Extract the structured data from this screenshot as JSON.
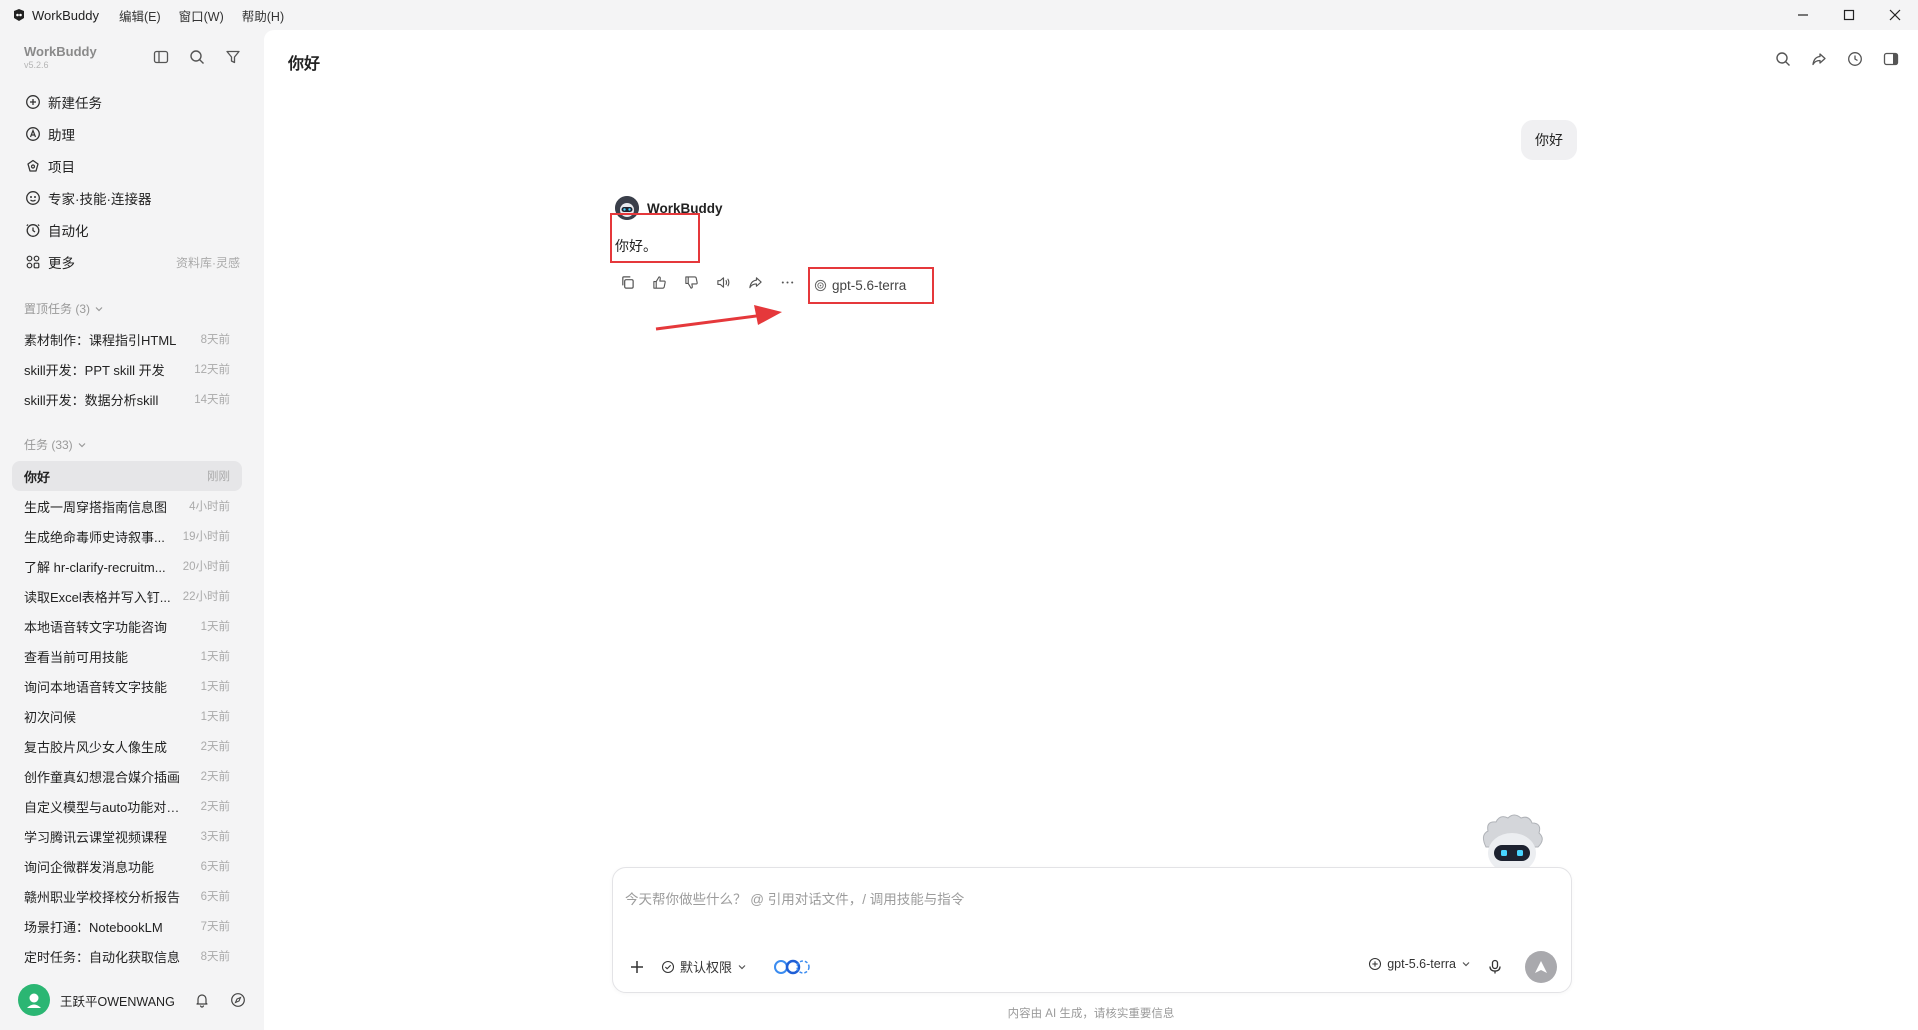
{
  "titlebar": {
    "app_name": "WorkBuddy",
    "menus": [
      "编辑(E)",
      "窗口(W)",
      "帮助(H)"
    ]
  },
  "sidebar": {
    "brand": "WorkBuddy",
    "version": "v5.2.6",
    "nav": [
      {
        "label": "新建任务",
        "icon": "plus-circle-icon"
      },
      {
        "label": "助理",
        "icon": "assistant-icon"
      },
      {
        "label": "项目",
        "icon": "project-icon"
      },
      {
        "label": "专家·技能·连接器",
        "icon": "expert-icon"
      },
      {
        "label": "自动化",
        "icon": "clock-icon"
      },
      {
        "label": "更多",
        "icon": "grid-icon",
        "sub": "资料库·灵感"
      }
    ],
    "pinned_title": "置顶任务 (3)",
    "pinned": [
      {
        "title": "素材制作：课程指引HTML",
        "time": "8天前"
      },
      {
        "title": "skill开发：PPT skill 开发",
        "time": "12天前"
      },
      {
        "title": "skill开发：数据分析skill",
        "time": "14天前"
      }
    ],
    "tasks_title": "任务 (33)",
    "tasks": [
      {
        "title": "你好",
        "time": "刚刚"
      },
      {
        "title": "生成一周穿搭指南信息图",
        "time": "4小时前"
      },
      {
        "title": "生成绝命毒师史诗叙事...",
        "time": "19小时前"
      },
      {
        "title": "了解 hr-clarify-recruitm...",
        "time": "20小时前"
      },
      {
        "title": "读取Excel表格并写入钉...",
        "time": "22小时前"
      },
      {
        "title": "本地语音转文字功能咨询",
        "time": "1天前"
      },
      {
        "title": "查看当前可用技能",
        "time": "1天前"
      },
      {
        "title": "询问本地语音转文字技能",
        "time": "1天前"
      },
      {
        "title": "初次问候",
        "time": "1天前"
      },
      {
        "title": "复古胶片风少女人像生成",
        "time": "2天前"
      },
      {
        "title": "创作童真幻想混合媒介插画",
        "time": "2天前"
      },
      {
        "title": "自定义模型与auto功能对比...",
        "time": "2天前"
      },
      {
        "title": "学习腾讯云课堂视频课程",
        "time": "3天前"
      },
      {
        "title": "询问企微群发消息功能",
        "time": "6天前"
      },
      {
        "title": "赣州职业学校择校分析报告",
        "time": "6天前"
      },
      {
        "title": "场景打通：NotebookLM",
        "time": "7天前"
      },
      {
        "title": "定时任务：自动化获取信息",
        "time": "8天前"
      }
    ],
    "user_name": "王跃平OWENWANG"
  },
  "main": {
    "title": "你好",
    "user_message": "你好",
    "bot_name": "WorkBuddy",
    "bot_message": "你好。",
    "model_tag": "gpt-5.6-terra"
  },
  "composer": {
    "placeholder": "今天帮你做些什么？ @ 引用对话文件，/ 调用技能与指令",
    "permission": "默认权限",
    "model": "gpt-5.6-terra"
  },
  "footnote": "内容由 AI 生成，请核实重要信息",
  "colors": {
    "highlight": "#e5383b",
    "sidebar_bg": "#f4f4f5",
    "main_bg": "#ffffff",
    "send_button": "#a9a9ad"
  }
}
